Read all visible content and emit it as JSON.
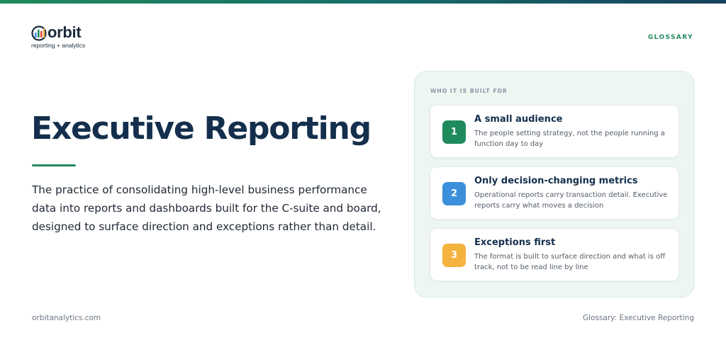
{
  "brand": {
    "name": "orbit",
    "tagline": "reporting + analytics",
    "accent_color": "#228b5f",
    "top_bar_gradient": [
      "#1f8a5c",
      "#176f6a",
      "#17405e"
    ]
  },
  "header": {
    "section_label": "GLOSSARY"
  },
  "main": {
    "title": "Executive Reporting",
    "definition": "The practice of consolidating high-level business performance data into reports and dashboards built for the C-suite and board, designed to surface direction and exceptions rather than detail."
  },
  "panel": {
    "label": "WHO IT IS BUILT FOR",
    "items": [
      {
        "number": "1",
        "title": "A small audience",
        "description": "The people setting strategy, not the people running a function day to day",
        "color": "#1f8a5c"
      },
      {
        "number": "2",
        "title": "Only decision-changing metrics",
        "description": "Operational reports carry transaction detail. Executive reports carry what moves a decision",
        "color": "#3b8fdb"
      },
      {
        "number": "3",
        "title": "Exceptions first",
        "description": "The format is built to surface direction and what is off track, not to be read line by line",
        "color": "#f4b23f"
      }
    ]
  },
  "footer": {
    "website": "orbitanalytics.com",
    "page_label": "Glossary: Executive Reporting"
  }
}
